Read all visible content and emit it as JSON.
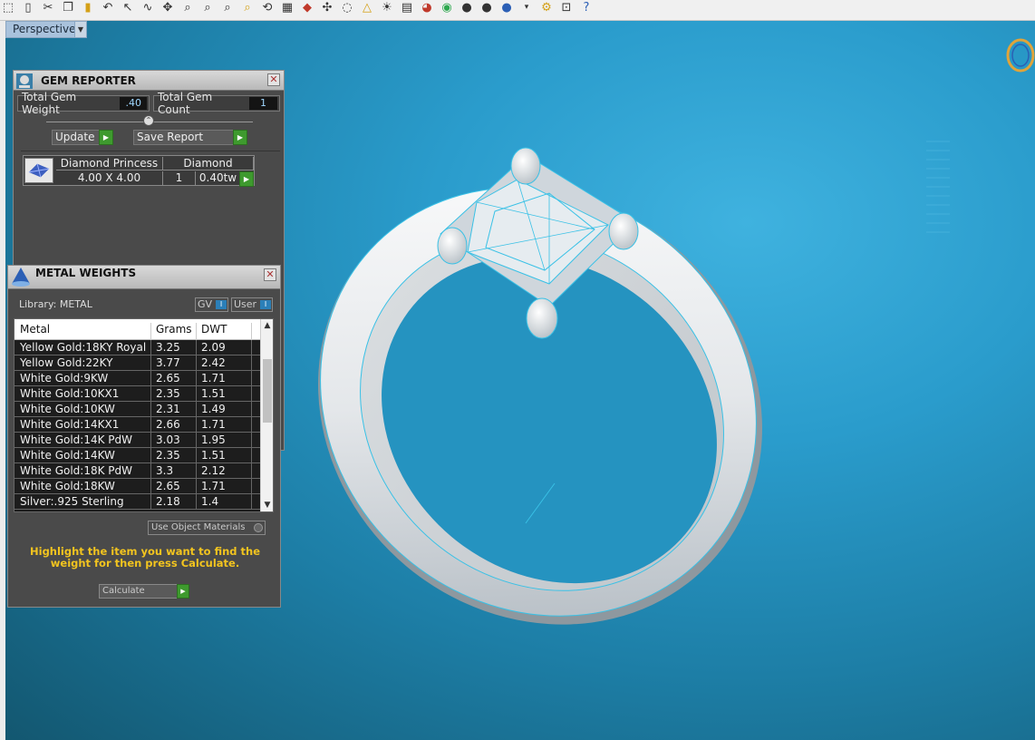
{
  "toolbar": {
    "icons": [
      "select-icon",
      "new-icon",
      "cut-icon",
      "copy-icon",
      "paste-icon",
      "undo-icon",
      "pointer-icon",
      "curve-icon",
      "pan-icon",
      "zoom-icon",
      "zoom-window-icon",
      "zoom-extents-icon",
      "zoom-selected-icon",
      "rotate-icon",
      "layout-icon",
      "car-icon",
      "gumball-icon",
      "orbit-icon",
      "warning-icon",
      "light-icon",
      "document-icon",
      "render-icon",
      "color-wheel-icon",
      "material-sphere-icon",
      "material-sphere-dark-icon",
      "globe-icon",
      "settings-icon",
      "snap-icon",
      "help-icon"
    ]
  },
  "viewport": {
    "label": "Perspective",
    "dropdown_glyph": "▼"
  },
  "gem_reporter": {
    "title": "GEM REPORTER",
    "close_glyph": "✕",
    "total_weight_label": "Total Gem Weight",
    "total_weight_value": ".40",
    "total_count_label": "Total Gem Count",
    "total_count_value": "1",
    "update_label": "Update",
    "save_report_label": "Save Report",
    "go_glyph": "▶",
    "gem": {
      "cut": "Diamond Princess",
      "type": "Diamond",
      "size": "4.00 X 4.00",
      "count": "1",
      "weight": "0.40tw"
    }
  },
  "metal_weights": {
    "title": "METAL WEIGHTS",
    "close_glyph": "✕",
    "library_label": "Library: METAL",
    "gv_label": "GV",
    "user_label": "User",
    "toggle_glyph": "I",
    "columns": [
      "Metal",
      "Grams",
      "DWT"
    ],
    "rows": [
      {
        "metal": "Yellow Gold:18KY Royal",
        "grams": "3.25",
        "dwt": "2.09"
      },
      {
        "metal": "Yellow Gold:22KY",
        "grams": "3.77",
        "dwt": "2.42"
      },
      {
        "metal": "White Gold:9KW",
        "grams": "2.65",
        "dwt": "1.71"
      },
      {
        "metal": "White Gold:10KX1",
        "grams": "2.35",
        "dwt": "1.51"
      },
      {
        "metal": "White Gold:10KW",
        "grams": "2.31",
        "dwt": "1.49"
      },
      {
        "metal": "White Gold:14KX1",
        "grams": "2.66",
        "dwt": "1.71"
      },
      {
        "metal": "White Gold:14K PdW",
        "grams": "3.03",
        "dwt": "1.95"
      },
      {
        "metal": "White Gold:14KW",
        "grams": "2.35",
        "dwt": "1.51"
      },
      {
        "metal": "White Gold:18K PdW",
        "grams": "3.3",
        "dwt": "2.12"
      },
      {
        "metal": "White Gold:18KW",
        "grams": "2.65",
        "dwt": "1.71"
      },
      {
        "metal": "Silver:.925 Sterling",
        "grams": "2.18",
        "dwt": "1.4"
      }
    ],
    "use_object_materials_label": "Use Object Materials",
    "hint": "Highlight the item you want to find the weight for then press Calculate.",
    "calculate_label": "Calculate",
    "scroll_up_glyph": "▲",
    "scroll_down_glyph": "▼",
    "go_glyph": "▶"
  },
  "colors": {
    "viewport_accent": "#2a9ccc",
    "hint_text": "#f2c41f",
    "go_button": "#3e9a2e",
    "wireframe": "#39c1e6"
  }
}
